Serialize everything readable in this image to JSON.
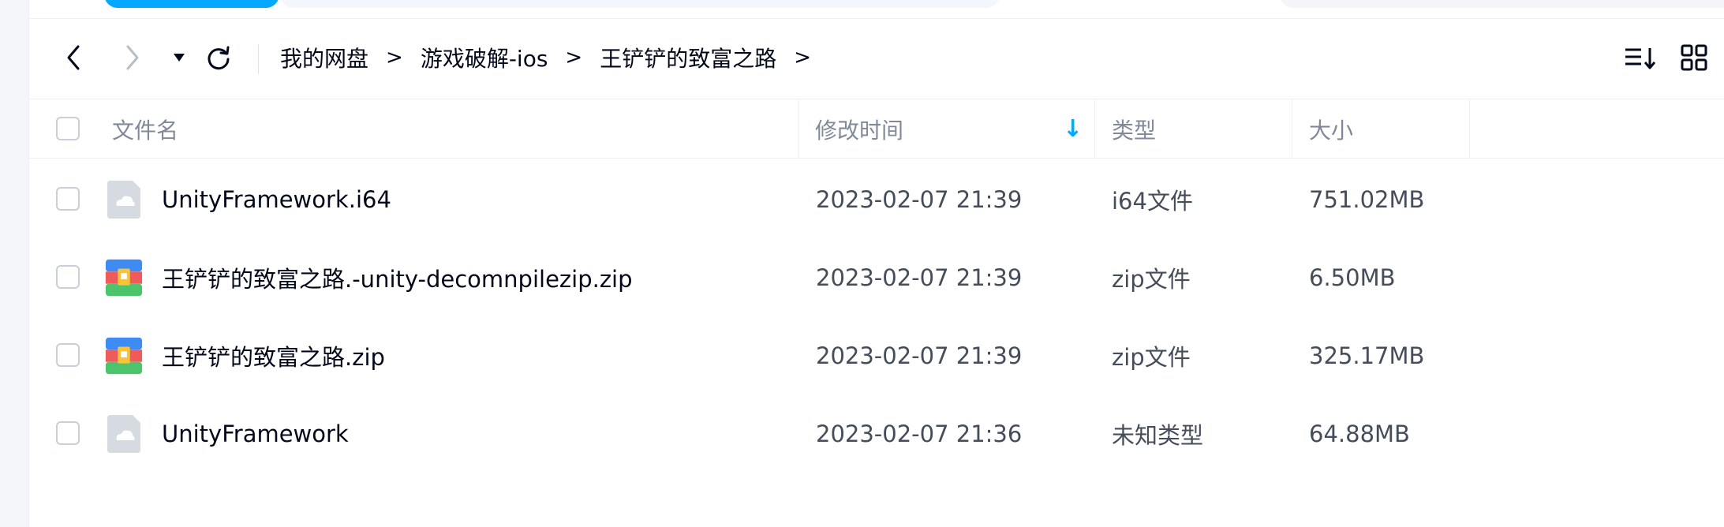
{
  "nav": {
    "back_icon": "chevron-left-icon",
    "forward_icon": "chevron-right-icon",
    "history_icon": "caret-down-icon",
    "refresh_icon": "refresh-icon",
    "breadcrumb": [
      "我的网盘",
      "游戏破解-ios",
      "王铲铲的致富之路"
    ],
    "separator": ">",
    "sort_icon": "sort-list-icon",
    "view_icon": "grid-view-icon"
  },
  "table": {
    "headers": {
      "name": "文件名",
      "modified": "修改时间",
      "type": "类型",
      "size": "大小"
    },
    "sort_arrow": "↓",
    "rows": [
      {
        "name": "UnityFramework.i64",
        "modified": "2023-02-07 21:39",
        "type": "i64文件",
        "size": "751.02MB",
        "icon": "unknown-file-icon"
      },
      {
        "name": "王铲铲的致富之路.-unity-decomnpilezip.zip",
        "modified": "2023-02-07 21:39",
        "type": "zip文件",
        "size": "6.50MB",
        "icon": "zip-archive-icon"
      },
      {
        "name": "王铲铲的致富之路.zip",
        "modified": "2023-02-07 21:39",
        "type": "zip文件",
        "size": "325.17MB",
        "icon": "zip-archive-icon"
      },
      {
        "name": "UnityFramework",
        "modified": "2023-02-07 21:36",
        "type": "未知类型",
        "size": "64.88MB",
        "icon": "unknown-file-icon"
      }
    ]
  },
  "colors": {
    "accent": "#06a7ff",
    "text": "#03081a",
    "muted": "#818999"
  }
}
